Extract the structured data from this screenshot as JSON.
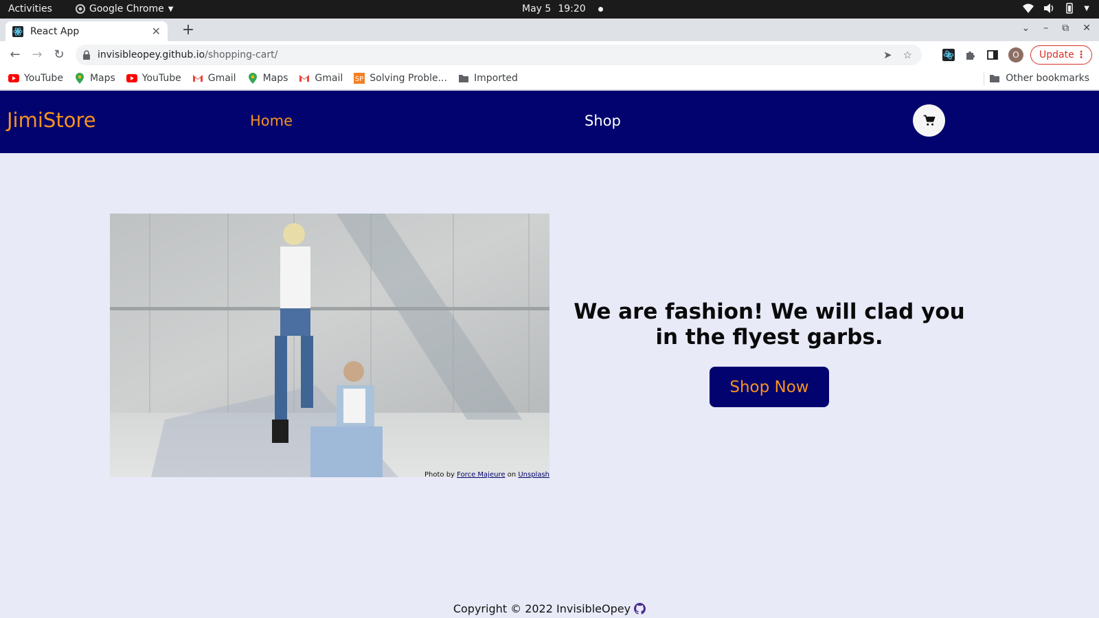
{
  "os": {
    "activities": "Activities",
    "app_name": "Google Chrome",
    "date": "May 5",
    "time": "19:20"
  },
  "browser": {
    "tab_title": "React App",
    "url_host": "invisibleopey.github.io",
    "url_path": "/shopping-cart/",
    "profile_initial": "O",
    "update_label": "Update",
    "bookmarks": [
      {
        "label": "YouTube",
        "icon": "youtube-icon"
      },
      {
        "label": "Maps",
        "icon": "maps-icon"
      },
      {
        "label": "YouTube",
        "icon": "youtube-icon"
      },
      {
        "label": "Gmail",
        "icon": "gmail-icon"
      },
      {
        "label": "Maps",
        "icon": "maps-icon"
      },
      {
        "label": "Gmail",
        "icon": "gmail-icon"
      },
      {
        "label": "Solving Proble...",
        "icon": "sp-icon"
      },
      {
        "label": "Imported",
        "icon": "folder-icon"
      }
    ],
    "other_bookmarks": "Other bookmarks"
  },
  "app": {
    "brand": "JimiStore",
    "nav": {
      "home": "Home",
      "shop": "Shop"
    },
    "hero": {
      "headline": "We are fashion! We will clad you in the flyest garbs.",
      "cta": "Shop Now",
      "credit_prefix": "Photo by",
      "credit_author": "Force Majeure",
      "credit_on": "on",
      "credit_site": "Unsplash"
    },
    "footer": "Copyright © 2022 InvisibleOpey"
  },
  "colors": {
    "header_bg": "#02036e",
    "accent": "#f7931e",
    "page_bg": "#e8eaf8"
  }
}
